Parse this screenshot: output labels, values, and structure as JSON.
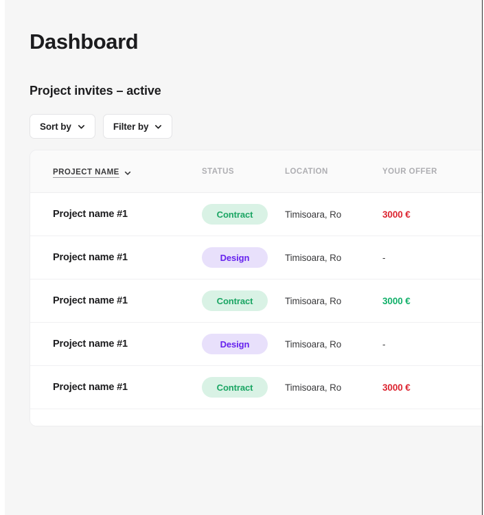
{
  "page": {
    "title": "Dashboard",
    "section_title": "Project invites – active"
  },
  "controls": [
    {
      "label": "Sort by",
      "icon": "chevron-down-icon"
    },
    {
      "label": "Filter by",
      "icon": "chevron-down-icon"
    }
  ],
  "table": {
    "columns": [
      {
        "key": "project_name",
        "label": "PROJECT NAME",
        "sorted": true,
        "sort_icon": "chevron-down-icon"
      },
      {
        "key": "status",
        "label": "STATUS",
        "sorted": false
      },
      {
        "key": "location",
        "label": "LOCATION",
        "sorted": false
      },
      {
        "key": "your_offer",
        "label": "YOUR OFFER",
        "sorted": false
      }
    ],
    "rows": [
      {
        "project_name": "Project name #1",
        "status": "Contract",
        "status_kind": "contract",
        "location": "Timisoara, Ro",
        "your_offer": "3000 €",
        "offer_kind": "red"
      },
      {
        "project_name": "Project name #1",
        "status": "Design",
        "status_kind": "design",
        "location": "Timisoara, Ro",
        "your_offer": "-",
        "offer_kind": "none"
      },
      {
        "project_name": "Project name #1",
        "status": "Contract",
        "status_kind": "contract",
        "location": "Timisoara, Ro",
        "your_offer": "3000 €",
        "offer_kind": "green"
      },
      {
        "project_name": "Project name #1",
        "status": "Design",
        "status_kind": "design",
        "location": "Timisoara, Ro",
        "your_offer": "-",
        "offer_kind": "none"
      },
      {
        "project_name": "Project name #1",
        "status": "Contract",
        "status_kind": "contract",
        "location": "Timisoara, Ro",
        "your_offer": "3000 €",
        "offer_kind": "red"
      }
    ]
  },
  "colors": {
    "page_background": "#f6f6f6",
    "card_background": "#ffffff",
    "text_primary": "#1c1c1e",
    "text_muted": "#aeaeb2",
    "offer_red": "#dc2430",
    "offer_green": "#12b06a",
    "pill_contract_bg": "#d9f2e5",
    "pill_contract_text": "#1aa563",
    "pill_design_bg": "#e8e0fb",
    "pill_design_text": "#6622ee"
  }
}
